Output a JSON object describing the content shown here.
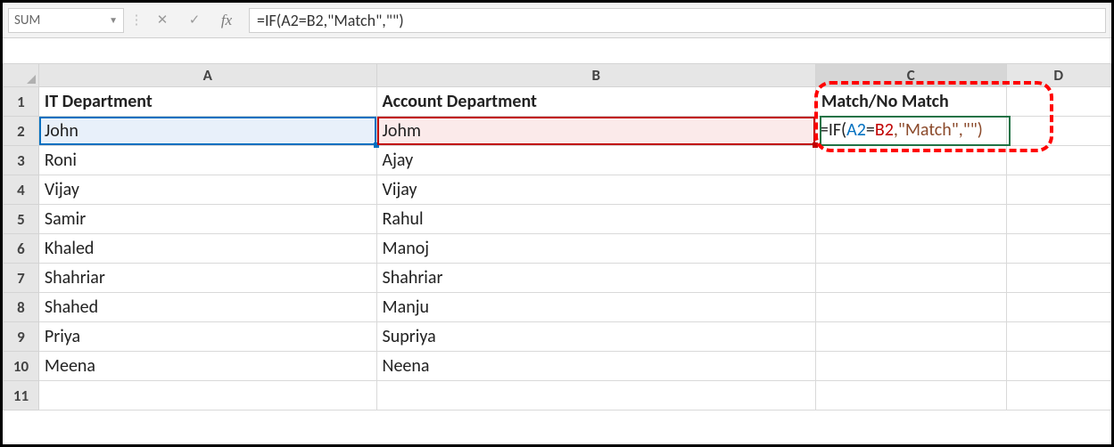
{
  "formula_bar": {
    "name_box": "SUM",
    "fx_label": "fx",
    "formula": "=IF(A2=B2,\"Match\",\"\")"
  },
  "columns": [
    "A",
    "B",
    "C",
    "D"
  ],
  "headers": {
    "A": "IT Department",
    "B": "Account Department",
    "C": "Match/No Match"
  },
  "rows": [
    {
      "n": 1
    },
    {
      "n": 2,
      "A": "John",
      "B": "Johm"
    },
    {
      "n": 3,
      "A": "Roni",
      "B": "Ajay"
    },
    {
      "n": 4,
      "A": "Vijay",
      "B": "Vijay"
    },
    {
      "n": 5,
      "A": "Samir",
      "B": "Rahul"
    },
    {
      "n": 6,
      "A": "Khaled",
      "B": "Manoj"
    },
    {
      "n": 7,
      "A": "Shahriar",
      "B": "Shahriar"
    },
    {
      "n": 8,
      "A": "Shahed",
      "B": "Manju"
    },
    {
      "n": 9,
      "A": "Priya",
      "B": "Supriya"
    },
    {
      "n": 10,
      "A": "Meena",
      "B": "Neena"
    },
    {
      "n": 11
    }
  ],
  "editing_cell": {
    "tokens": [
      "=IF(",
      "A2",
      "=",
      "B2",
      ",\"Match\",\"\")"
    ],
    "token_classes": [
      "",
      "tok-blue",
      "",
      "tok-red",
      "tok-brown"
    ]
  },
  "active_cell": "C2",
  "referenced_cells": {
    "A2": "blue",
    "B2": "red"
  },
  "callout_region": "C1:C2"
}
